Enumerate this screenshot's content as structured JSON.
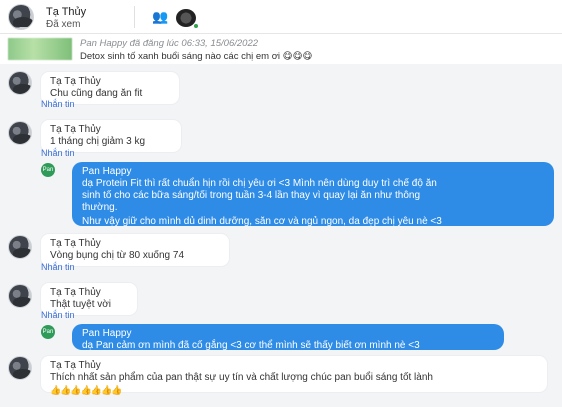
{
  "header": {
    "name": "Tạ Thủy",
    "status": "Đã xem",
    "people_icon": "person-add-icon"
  },
  "post": {
    "meta": "Pan Happy đã đăng lúc 06:33, 15/06/2022",
    "text": "Detox sinh tố xanh buổi sáng nào các chị em ơi 😋😋😋"
  },
  "messages": [
    {
      "sender": "Tạ Tạ Thủy",
      "text": "Chu cũng đang ăn fit",
      "reply": "Nhắn tin"
    },
    {
      "sender": "Tạ Tạ Thủy",
      "text": "1 tháng chị giảm 3 kg",
      "reply": "Nhắn tin"
    },
    {
      "sender": "Pan Happy",
      "lines": [
        "dạ Protein Fit thì rất chuẩn hịn rồi chị yêu ơi <3 Mình nên dùng duy trì chế độ ăn",
        "sinh tố cho các bữa sáng/tối trong tuần 3-4 lần thay vì quay lại ăn như thông",
        "thường.",
        "Như vậy giữ cho mình dủ dinh dưỡng, săn cơ và ngủ ngon, da đẹp chị yêu nè <3"
      ],
      "page_badge": "Pan"
    },
    {
      "sender": "Tạ Tạ Thủy",
      "text": "Vòng bụng chị từ 80 xuống 74",
      "reply": "Nhắn tin"
    },
    {
      "sender": "Tạ Tạ Thủy",
      "text": "Thật tuyệt vời",
      "reply": "Nhắn tin"
    },
    {
      "sender": "Pan Happy",
      "text": "dạ Pan cảm ơn mình đã cố gắng <3 cơ thể mình sẽ thấy biết ơn mình nè <3",
      "page_badge": "Pan"
    },
    {
      "sender": "Tạ Tạ Thủy",
      "text": "Thích nhất sản phẩm của pan thật sự uy tín và chất lượng chúc pan buổi sáng tốt lành",
      "emoji": "👍👍👍👍👍👍👍"
    }
  ]
}
